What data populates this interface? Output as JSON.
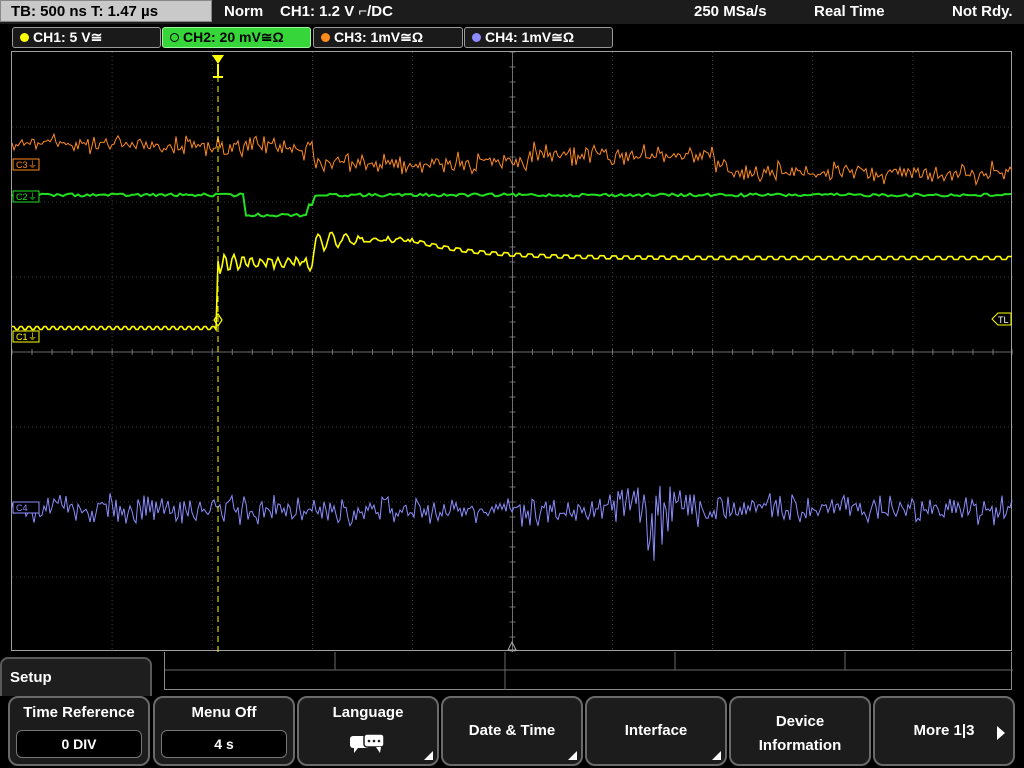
{
  "status": {
    "timebase": "TB: 500 ns  T: 1.47 µs",
    "trigger_mode": "Norm",
    "trigger": "CH1: 1.2 V ⌐/DC",
    "sample_rate": "250 MSa/s",
    "acq_mode": "Real Time",
    "state": "Not Rdy."
  },
  "channels": [
    {
      "label": "CH1: 5 V≅",
      "color": "#ffff00",
      "active": false
    },
    {
      "label": "CH2: 20 mV≅Ω",
      "color": "#36d63a",
      "active": true
    },
    {
      "label": "CH3: 1mV≅Ω",
      "color": "#ff8a1e",
      "active": false
    },
    {
      "label": "CH4: 1mV≅Ω",
      "color": "#8c8cff",
      "active": false
    }
  ],
  "markers": {
    "c3": "C3",
    "c2": "C2",
    "c1": "C1",
    "c4": "C4",
    "trigger_level": "TL"
  },
  "menu": {
    "title": "Setup",
    "time_reference": {
      "label": "Time Reference",
      "value": "0 DIV"
    },
    "menu_off": {
      "label": "Menu Off",
      "value": "4 s"
    },
    "language": {
      "label": "Language"
    },
    "date_time": {
      "label": "Date & Time"
    },
    "interface": {
      "label": "Interface"
    },
    "device_info": {
      "line1": "Device",
      "line2": "Information"
    },
    "more": {
      "label": "More 1|3"
    }
  },
  "colors": {
    "ch1": "#ffff00",
    "ch2": "#22e01f",
    "ch3": "#ff8a1e",
    "ch4": "#8c8cff",
    "grid": "#6a6a6a"
  }
}
